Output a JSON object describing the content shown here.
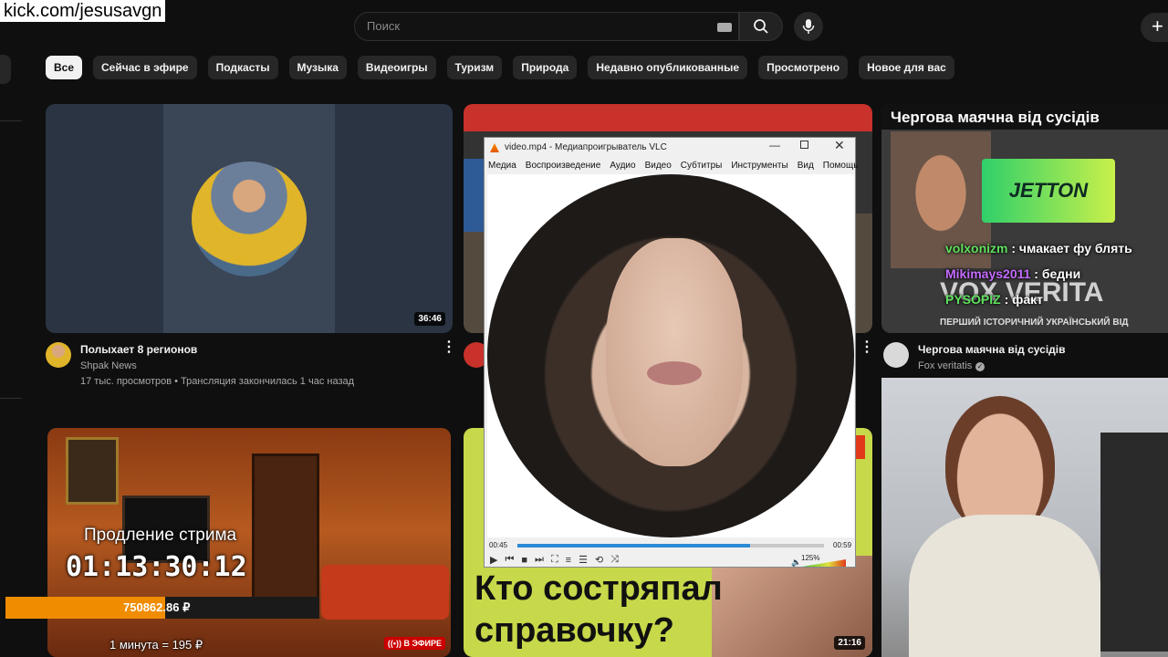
{
  "overlay": {
    "channel_url": "kick.com/jesusavgn"
  },
  "topbar": {
    "search_placeholder": "Поиск",
    "create_label": "+"
  },
  "chips": [
    "Все",
    "Сейчас в эфире",
    "Подкасты",
    "Музыка",
    "Видеоигры",
    "Туризм",
    "Природа",
    "Недавно опубликованные",
    "Просмотрено",
    "Новое для вас"
  ],
  "videos": [
    {
      "title": "Полыхает 8 регионов",
      "channel": "Shpak News",
      "meta": "17 тыс. просмотров • Трансляция закончилась 1 час назад",
      "duration": "36:46"
    },
    {
      "title": "Чергова маячна від сусідів",
      "channel": "Fox veritatis",
      "duration": "",
      "thumb_title": "Чергова маячна від сусідів",
      "thumb_subtitle": "ПЕРШИЙ ІСТОРИЧНИЙ УКРАЇНСЬКИЙ ВІД",
      "thumb_brand": "VOX VERITA",
      "sponsor": "JETTON"
    },
    {
      "title": "Кто состряпал справочку?",
      "duration": "21:16"
    },
    {
      "live_label": "В ЭФИРЕ"
    }
  ],
  "chat": [
    {
      "user": "volxonizm",
      "text": ": чмакает фу блять"
    },
    {
      "user": "Mikimays2011",
      "text": ": бедни"
    },
    {
      "user": "PYSOPIZ",
      "text": ": факт"
    }
  ],
  "stream_overlay": {
    "extension_label": "Продление стрима",
    "timer": "01:13:30:12",
    "donation_total": "750862.86 ₽",
    "rate": "1 минута = 195 ₽",
    "partial_duration": "1"
  },
  "vlc": {
    "window_title": "video.mp4 - Медиапроигрыватель VLC",
    "menu": [
      "Медиа",
      "Воспроизведение",
      "Аудио",
      "Видео",
      "Субтитры",
      "Инструменты",
      "Вид",
      "Помощь"
    ],
    "elapsed": "00:45",
    "total": "00:59",
    "volume_label": "125%",
    "progress": 0.76
  },
  "colors": {
    "background": "#0f0f0f",
    "chip": "#272727",
    "accent_orange": "#f08c00",
    "live_red": "#cc0000"
  }
}
